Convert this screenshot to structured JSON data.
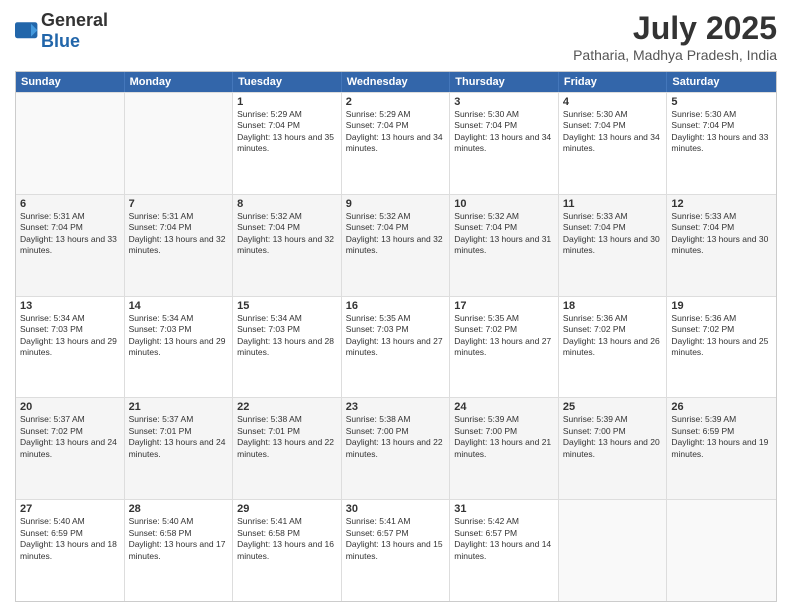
{
  "logo": {
    "general": "General",
    "blue": "Blue"
  },
  "header": {
    "title": "July 2025",
    "subtitle": "Patharia, Madhya Pradesh, India"
  },
  "calendar": {
    "days": [
      "Sunday",
      "Monday",
      "Tuesday",
      "Wednesday",
      "Thursday",
      "Friday",
      "Saturday"
    ],
    "rows": [
      [
        {
          "day": "",
          "empty": true
        },
        {
          "day": "",
          "empty": true
        },
        {
          "day": "1",
          "sunrise": "5:29 AM",
          "sunset": "7:04 PM",
          "daylight": "13 hours and 35 minutes."
        },
        {
          "day": "2",
          "sunrise": "5:29 AM",
          "sunset": "7:04 PM",
          "daylight": "13 hours and 34 minutes."
        },
        {
          "day": "3",
          "sunrise": "5:30 AM",
          "sunset": "7:04 PM",
          "daylight": "13 hours and 34 minutes."
        },
        {
          "day": "4",
          "sunrise": "5:30 AM",
          "sunset": "7:04 PM",
          "daylight": "13 hours and 34 minutes."
        },
        {
          "day": "5",
          "sunrise": "5:30 AM",
          "sunset": "7:04 PM",
          "daylight": "13 hours and 33 minutes."
        }
      ],
      [
        {
          "day": "6",
          "sunrise": "5:31 AM",
          "sunset": "7:04 PM",
          "daylight": "13 hours and 33 minutes."
        },
        {
          "day": "7",
          "sunrise": "5:31 AM",
          "sunset": "7:04 PM",
          "daylight": "13 hours and 32 minutes."
        },
        {
          "day": "8",
          "sunrise": "5:32 AM",
          "sunset": "7:04 PM",
          "daylight": "13 hours and 32 minutes."
        },
        {
          "day": "9",
          "sunrise": "5:32 AM",
          "sunset": "7:04 PM",
          "daylight": "13 hours and 32 minutes."
        },
        {
          "day": "10",
          "sunrise": "5:32 AM",
          "sunset": "7:04 PM",
          "daylight": "13 hours and 31 minutes."
        },
        {
          "day": "11",
          "sunrise": "5:33 AM",
          "sunset": "7:04 PM",
          "daylight": "13 hours and 30 minutes."
        },
        {
          "day": "12",
          "sunrise": "5:33 AM",
          "sunset": "7:04 PM",
          "daylight": "13 hours and 30 minutes."
        }
      ],
      [
        {
          "day": "13",
          "sunrise": "5:34 AM",
          "sunset": "7:03 PM",
          "daylight": "13 hours and 29 minutes."
        },
        {
          "day": "14",
          "sunrise": "5:34 AM",
          "sunset": "7:03 PM",
          "daylight": "13 hours and 29 minutes."
        },
        {
          "day": "15",
          "sunrise": "5:34 AM",
          "sunset": "7:03 PM",
          "daylight": "13 hours and 28 minutes."
        },
        {
          "day": "16",
          "sunrise": "5:35 AM",
          "sunset": "7:03 PM",
          "daylight": "13 hours and 27 minutes."
        },
        {
          "day": "17",
          "sunrise": "5:35 AM",
          "sunset": "7:02 PM",
          "daylight": "13 hours and 27 minutes."
        },
        {
          "day": "18",
          "sunrise": "5:36 AM",
          "sunset": "7:02 PM",
          "daylight": "13 hours and 26 minutes."
        },
        {
          "day": "19",
          "sunrise": "5:36 AM",
          "sunset": "7:02 PM",
          "daylight": "13 hours and 25 minutes."
        }
      ],
      [
        {
          "day": "20",
          "sunrise": "5:37 AM",
          "sunset": "7:02 PM",
          "daylight": "13 hours and 24 minutes."
        },
        {
          "day": "21",
          "sunrise": "5:37 AM",
          "sunset": "7:01 PM",
          "daylight": "13 hours and 24 minutes."
        },
        {
          "day": "22",
          "sunrise": "5:38 AM",
          "sunset": "7:01 PM",
          "daylight": "13 hours and 22 minutes."
        },
        {
          "day": "23",
          "sunrise": "5:38 AM",
          "sunset": "7:00 PM",
          "daylight": "13 hours and 22 minutes."
        },
        {
          "day": "24",
          "sunrise": "5:39 AM",
          "sunset": "7:00 PM",
          "daylight": "13 hours and 21 minutes."
        },
        {
          "day": "25",
          "sunrise": "5:39 AM",
          "sunset": "7:00 PM",
          "daylight": "13 hours and 20 minutes."
        },
        {
          "day": "26",
          "sunrise": "5:39 AM",
          "sunset": "6:59 PM",
          "daylight": "13 hours and 19 minutes."
        }
      ],
      [
        {
          "day": "27",
          "sunrise": "5:40 AM",
          "sunset": "6:59 PM",
          "daylight": "13 hours and 18 minutes."
        },
        {
          "day": "28",
          "sunrise": "5:40 AM",
          "sunset": "6:58 PM",
          "daylight": "13 hours and 17 minutes."
        },
        {
          "day": "29",
          "sunrise": "5:41 AM",
          "sunset": "6:58 PM",
          "daylight": "13 hours and 16 minutes."
        },
        {
          "day": "30",
          "sunrise": "5:41 AM",
          "sunset": "6:57 PM",
          "daylight": "13 hours and 15 minutes."
        },
        {
          "day": "31",
          "sunrise": "5:42 AM",
          "sunset": "6:57 PM",
          "daylight": "13 hours and 14 minutes."
        },
        {
          "day": "",
          "empty": true
        },
        {
          "day": "",
          "empty": true
        }
      ]
    ]
  }
}
